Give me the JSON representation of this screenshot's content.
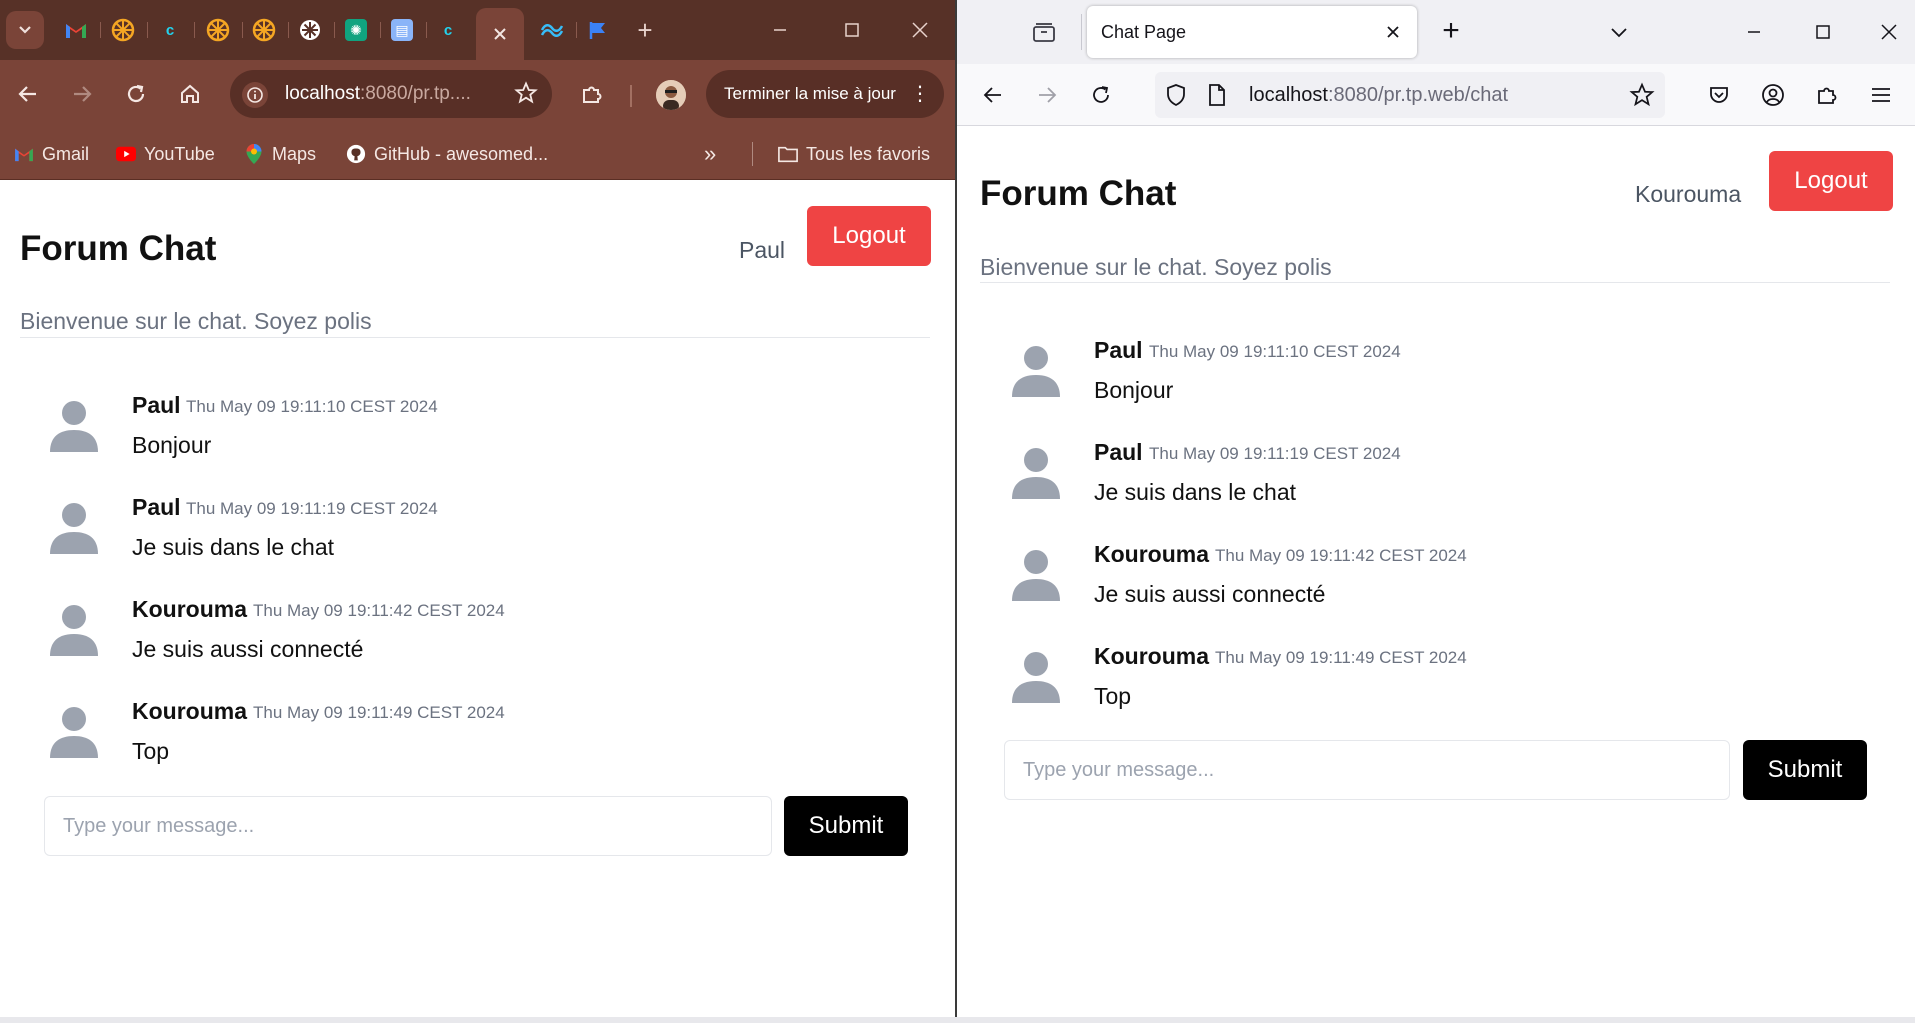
{
  "chrome": {
    "tabs": [
      "gmail-icon",
      "orange-seal-icon",
      "cyan-c-icon",
      "orange-seal-icon",
      "orange-seal-icon",
      "openai-icon",
      "openai-icon",
      "doc-icon",
      "cyan-c-icon",
      "close-icon",
      "tailwind-icon",
      "flag-icon"
    ],
    "address": {
      "host": "localhost",
      "path": ":8080/pr.tp...."
    },
    "update_label": "Terminer la mise à jour",
    "bookmarks": [
      {
        "label": "Gmail",
        "icon": "gmail-icon"
      },
      {
        "label": "YouTube",
        "icon": "youtube-icon"
      },
      {
        "label": "Maps",
        "icon": "maps-icon"
      },
      {
        "label": "GitHub - awesomed...",
        "icon": "github-icon"
      }
    ],
    "all_bookmarks": "Tous les favoris",
    "colors": {
      "tabbar": "#573127",
      "toolbar": "#7a4438"
    }
  },
  "firefox": {
    "tab_title": "Chat Page",
    "address": {
      "host": "localhost",
      "path": ":8080/pr.tp.web/chat"
    }
  },
  "left_page": {
    "title": "Forum Chat",
    "current_user": "Paul",
    "logout_label": "Logout",
    "welcome": "Bienvenue sur le chat. Soyez polis",
    "input_placeholder": "Type your message...",
    "submit_label": "Submit"
  },
  "right_page": {
    "title": "Forum Chat",
    "current_user": "Kourouma",
    "logout_label": "Logout",
    "welcome": "Bienvenue sur le chat. Soyez polis",
    "input_placeholder": "Type your message...",
    "submit_label": "Submit"
  },
  "messages": [
    {
      "author": "Paul",
      "time": "Thu May 09 19:11:10 CEST 2024",
      "text": "Bonjour"
    },
    {
      "author": "Paul",
      "time": "Thu May 09 19:11:19 CEST 2024",
      "text": "Je suis dans le chat"
    },
    {
      "author": "Kourouma",
      "time": "Thu May 09 19:11:42 CEST 2024",
      "text": "Je suis aussi connecté"
    },
    {
      "author": "Kourouma",
      "time": "Thu May 09 19:11:49 CEST 2024",
      "text": "Top"
    }
  ],
  "colors": {
    "logout": "#ef4444",
    "submit": "#000000",
    "avatar": "#9ca3af"
  }
}
